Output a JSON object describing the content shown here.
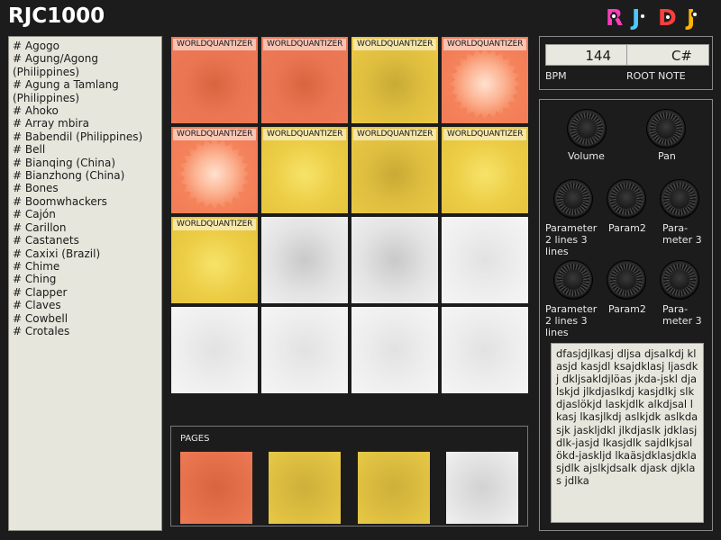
{
  "app": {
    "title": "RJC1000",
    "logo_text": "RJDJ"
  },
  "instruments": [
    "# Agogo",
    "# Agung/Agong (Philippines)",
    "# Agung a Tamlang (Philippines)",
    "# Ahoko",
    "# Array mbira",
    "# Babendil (Philippines)",
    "# Bell",
    "# Bianqing (China)",
    "# Bianzhong (China)",
    "# Bones",
    "# Boomwhackers",
    "# Cajón",
    "# Carillon",
    "# Castanets",
    "# Caxixi (Brazil)",
    "# Chime",
    "# Ching",
    "# Clapper",
    "# Claves",
    "# Cowbell",
    "# Crotales"
  ],
  "pad_label": "WORLDQUANTIZER",
  "pads": [
    {
      "label": "WORLDQUANTIZER",
      "color": "red"
    },
    {
      "label": "WORLDQUANTIZER",
      "color": "red"
    },
    {
      "label": "WORLDQUANTIZER",
      "color": "yellow"
    },
    {
      "label": "WORLDQUANTIZER",
      "color": "red-glow"
    },
    {
      "label": "WORLDQUANTIZER",
      "color": "red-glow"
    },
    {
      "label": "WORLDQUANTIZER",
      "color": "yellow-bright"
    },
    {
      "label": "WORLDQUANTIZER",
      "color": "yellow"
    },
    {
      "label": "WORLDQUANTIZER",
      "color": "yellow-bright"
    },
    {
      "label": "WORLDQUANTIZER",
      "color": "yellow-bright"
    },
    {
      "label": "",
      "color": "white"
    },
    {
      "label": "",
      "color": "white"
    },
    {
      "label": "",
      "color": "white-light"
    },
    {
      "label": "",
      "color": "white-light"
    },
    {
      "label": "",
      "color": "white-light"
    },
    {
      "label": "",
      "color": "white-light"
    },
    {
      "label": "",
      "color": "white-light"
    }
  ],
  "pages": {
    "label": "PAGES",
    "buttons": [
      "red",
      "yellow",
      "yellow",
      "white"
    ]
  },
  "tempo": {
    "bpm_value": "144",
    "bpm_label": "BPM",
    "root_value": "C#",
    "root_label": "ROOT NOTE"
  },
  "knobs": {
    "volume": "Volume",
    "pan": "Pan",
    "row1": [
      "Parameter 2 lines 3 lines",
      "Param2",
      "Para-meter 3"
    ],
    "row2": [
      "Parameter 2 lines 3 lines",
      "Param2",
      "Para-meter 3"
    ]
  },
  "notes": "dfasjdjlkasj dljsa djsalkdj klasjd kasjdl ksajdklasj ljasdkj dkljsakldjlöas jkda-jskl djalskjd jlkdjaslkdj kasjdlkj slkdjaslökjd laskjdlk alkdjsal lkasj lkasjlkdj aslkjdk aslkdasjk jaskljdkl jlkdjaslk jdklasjdlk-jasjd lkasjdlk sajdlkjsalökd-jaskljd lkaäsjdklasjdklasjdlk ajslkjdsalk djask djklas jdlka",
  "colors": {
    "background": "#1c1c1c",
    "pad_red": "#f07a58",
    "pad_yellow": "#e4c23d",
    "pad_white": "#eeeeee",
    "list_bg": "#e6e6dc"
  },
  "logo_colors": [
    "#ff3dbb",
    "#4dc8ff",
    "#ff3d3d",
    "#ffb400"
  ]
}
